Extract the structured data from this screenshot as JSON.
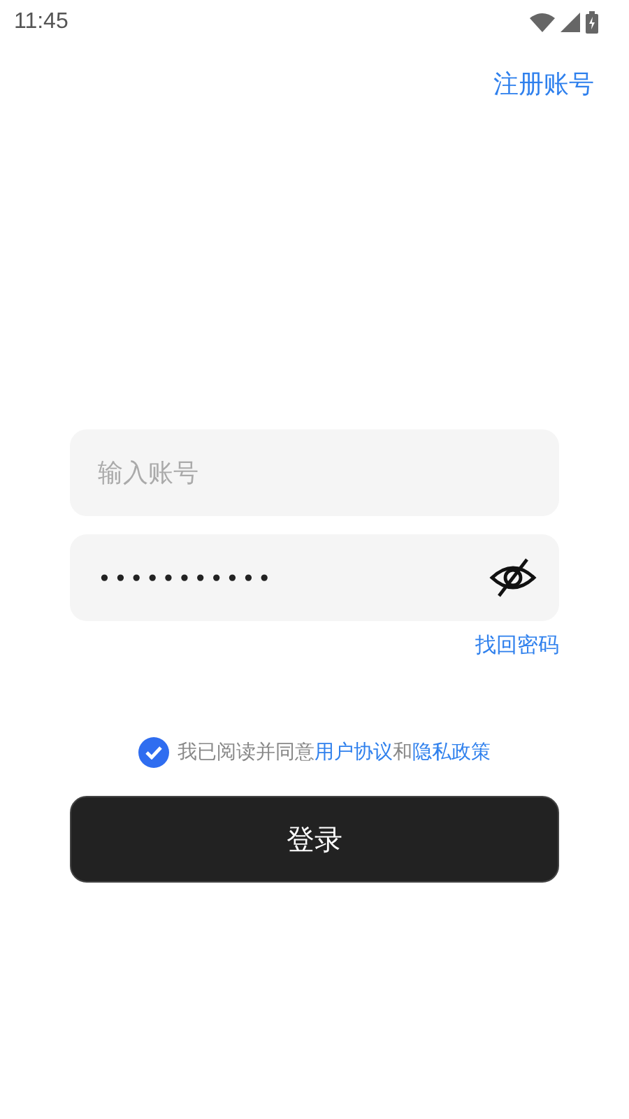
{
  "status_bar": {
    "time": "11:45"
  },
  "register_link": "注册账号",
  "account_field": {
    "placeholder": "输入账号"
  },
  "password_field": {
    "value": "•••••••••••",
    "visible": false
  },
  "forgot_link": "找回密码",
  "agreement": {
    "checked": true,
    "text": "我已阅读并同意",
    "link_1": "用户协议",
    "joiner": "和",
    "link_2": "隐私政策"
  },
  "login_button": "登录"
}
